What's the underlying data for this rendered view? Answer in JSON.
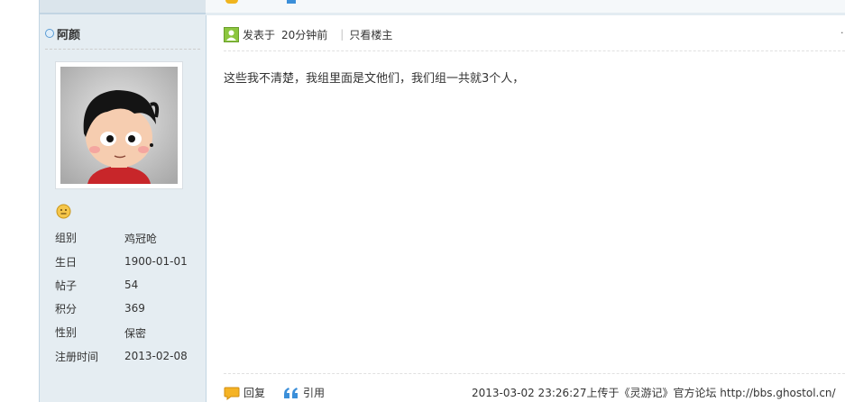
{
  "author": {
    "name": "阿颜",
    "online_icon": "online-status-icon"
  },
  "avatar": {
    "icon": "cartoon-boy-avatar"
  },
  "medal": {
    "icon": "smiley-face-icon"
  },
  "profile": [
    {
      "label": "组别",
      "value": "鸡冠呛"
    },
    {
      "label": "生日",
      "value": "1900-01-01"
    },
    {
      "label": "帖子",
      "value": "54"
    },
    {
      "label": "积分",
      "value": "369"
    },
    {
      "label": "性别",
      "value": "保密"
    },
    {
      "label": "注册时间",
      "value": "2013-02-08"
    }
  ],
  "post": {
    "posted_label": "发表于",
    "posted_time": "20分钟前",
    "author_only_link": "只看楼主",
    "content": "这些我不清楚，我组里面是文他们，我们组一共就3个人，"
  },
  "actions": {
    "reply_label": "回复",
    "quote_label": "引用"
  },
  "source": "2013-03-02 23:26:27上传于《灵游记》官方论坛 http://bbs.ghostol.cn/",
  "colors": {
    "sidebar_bg": "#e5edf2",
    "sidebar_border": "#c2d5e3",
    "accent_blue": "#3b8fd9"
  }
}
